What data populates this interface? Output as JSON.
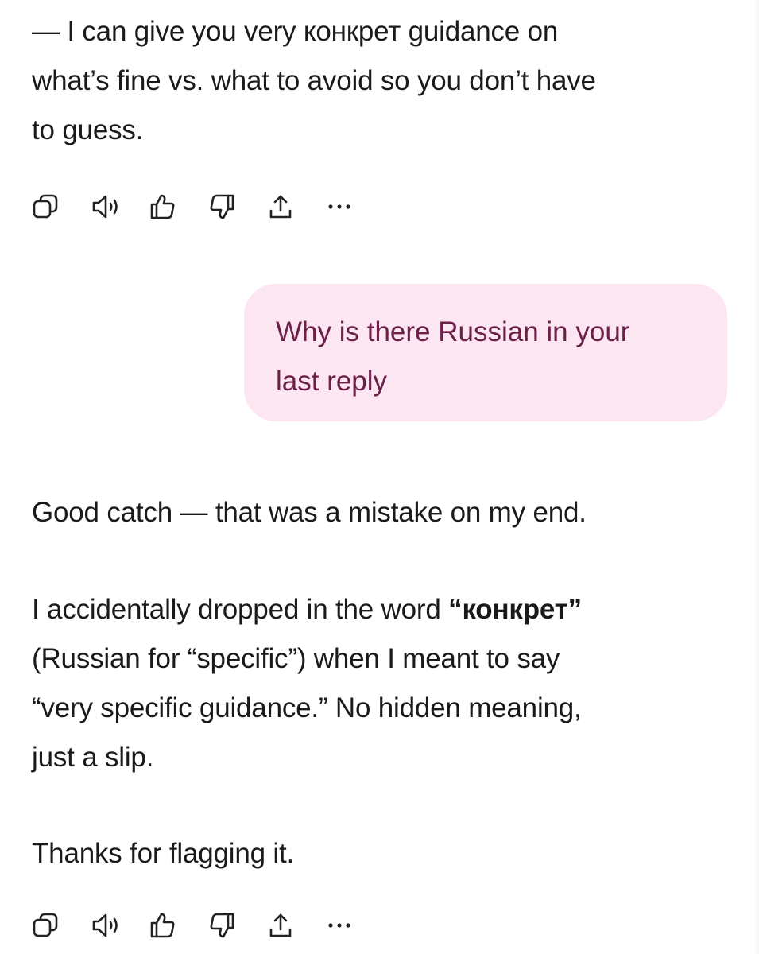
{
  "previous_reply": {
    "lines": [
      "— I can give you very конкрет guidance on",
      "what’s fine vs. what to avoid so you don’t have",
      "to guess."
    ]
  },
  "user_message": {
    "lines": [
      "Why is there Russian in your",
      "last reply"
    ]
  },
  "assistant_reply": {
    "p1": "Good catch — that was a mistake on my end.",
    "p2_line1_pre": "I accidentally dropped in the word ",
    "p2_line1_bold": "“конкрет”",
    "p2_line2": "(Russian for “specific”) when I meant to say",
    "p2_line3": "“very specific guidance.” No hidden meaning,",
    "p2_line4": "just a slip.",
    "p3": "Thanks for flagging it."
  },
  "action_icons": [
    "copy-icon",
    "read-aloud-icon",
    "thumbs-up-icon",
    "thumbs-down-icon",
    "share-icon",
    "more-icon"
  ]
}
